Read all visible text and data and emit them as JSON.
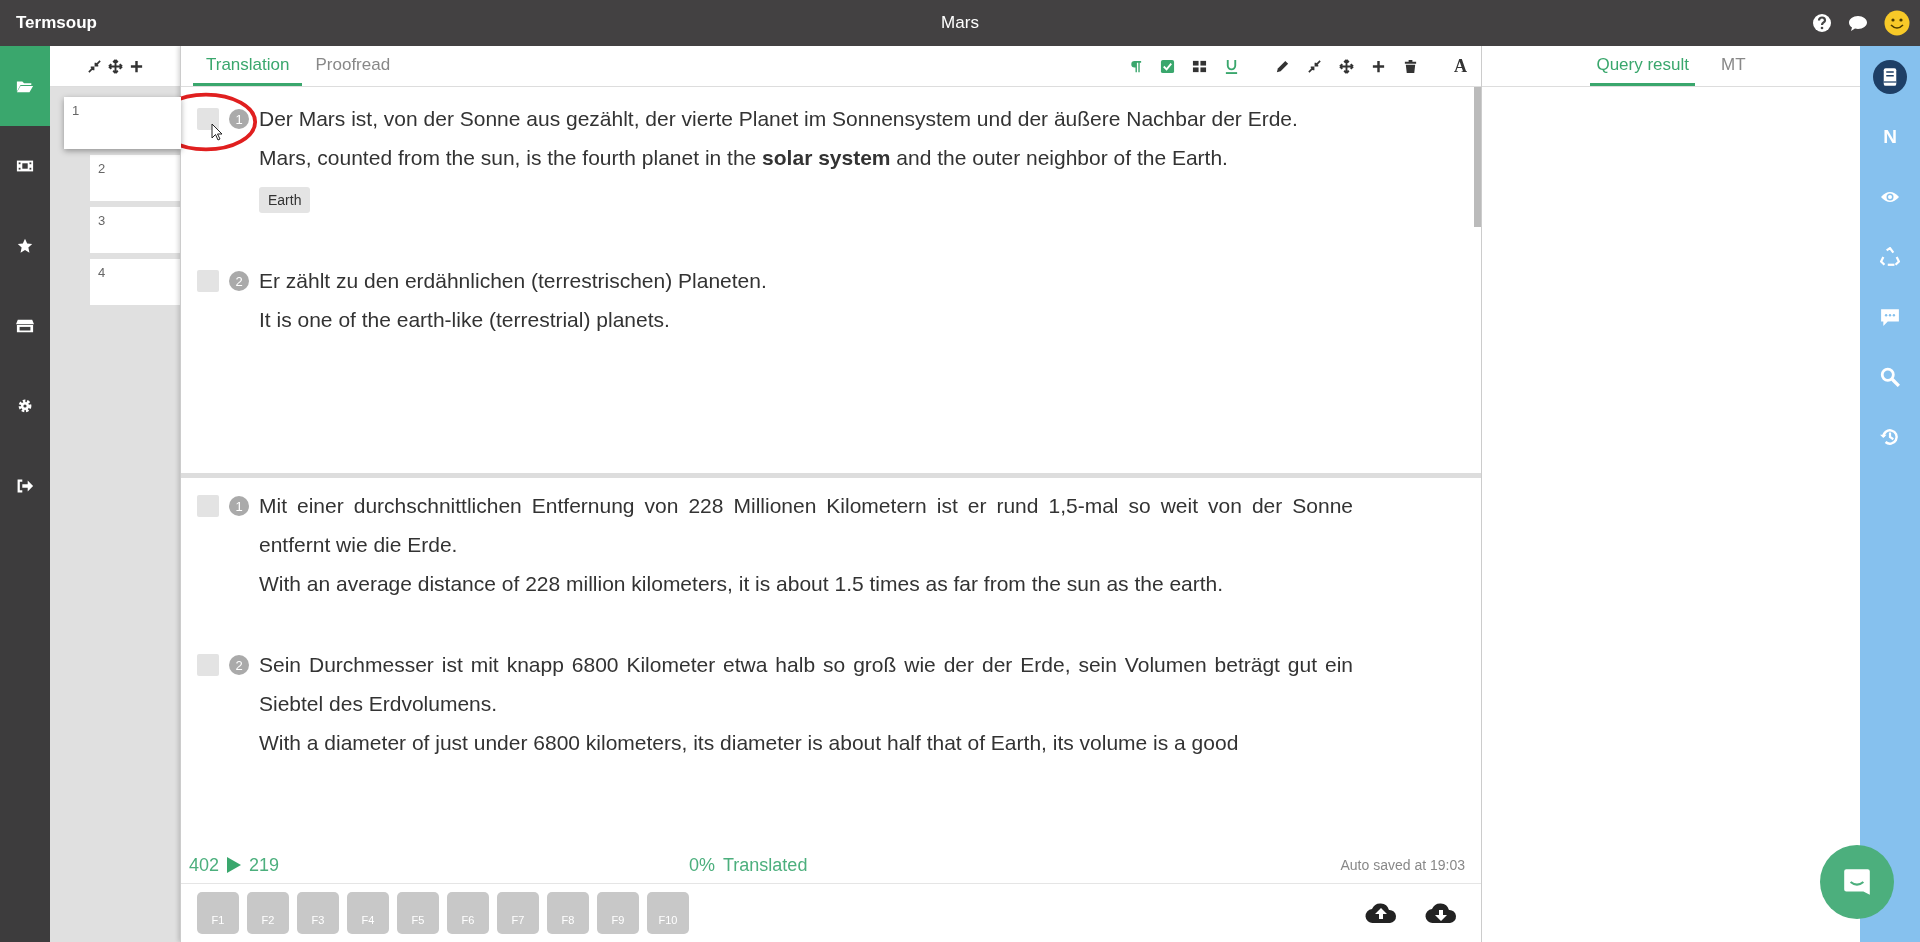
{
  "app": {
    "name": "Termsoup",
    "document_title": "Mars"
  },
  "left_nav": [
    {
      "selected": true
    },
    {
      "selected": false
    },
    {
      "selected": false
    },
    {
      "selected": false
    },
    {
      "selected": false
    },
    {
      "selected": false
    }
  ],
  "pages": [
    {
      "label": "1",
      "selected": true
    },
    {
      "label": "2",
      "selected": false
    },
    {
      "label": "3",
      "selected": false
    },
    {
      "label": "4",
      "selected": false
    }
  ],
  "editor_tabs": [
    {
      "label": "Translation",
      "selected": true
    },
    {
      "label": "Proofread",
      "selected": false
    }
  ],
  "toolbar": {
    "toggles": [
      {
        "on": true
      },
      {
        "on": true
      },
      {
        "on": false
      },
      {
        "on": true
      }
    ],
    "font_button": "A"
  },
  "panes": [
    {
      "segments": [
        {
          "number": "1",
          "checked": false,
          "source": "Der Mars ist, von der Sonne aus gezählt, der vierte Planet im Sonnensystem und der äußere Nachbar der Erde.",
          "target": "Mars, counted from the sun, is the fourth planet in the **solar system** and the outer neighbor of the Earth.",
          "terms": [
            "Earth"
          ]
        },
        {
          "number": "2",
          "checked": false,
          "source": "Er zählt zu den erdähnlichen (terrestrischen) Planeten.",
          "target": "It is one of the earth-like (terrestrial) planets."
        }
      ]
    },
    {
      "segments": [
        {
          "number": "1",
          "checked": false,
          "source": "Mit einer durchschnittlichen Entfernung von 228 Millionen Kilometern ist er rund 1,5-mal so weit von der Sonne entfernt wie die Erde.",
          "target": "With an average distance of 228 million kilometers, it is about 1.5 times as far from the sun as the earth."
        },
        {
          "number": "2",
          "checked": false,
          "source": "Sein Durchmesser ist mit knapp 6800 Kilometer etwa halb so groß wie der der Erde, sein Volumen beträgt gut ein Siebtel des Erdvolumens.",
          "target": "With a diameter of just under 6800 kilometers, its diameter is about half that of Earth, its volume is a good"
        }
      ]
    }
  ],
  "status": {
    "source_count": "402",
    "target_count": "219",
    "progress": "0%",
    "progress_label": "Translated",
    "autosave": "Auto saved at 19:03"
  },
  "function_keys": [
    "F1",
    "F2",
    "F3",
    "F4",
    "F5",
    "F6",
    "F7",
    "F8",
    "F9",
    "F10"
  ],
  "right_tabs": [
    {
      "label": "Query result",
      "selected": true
    },
    {
      "label": "MT",
      "selected": false
    }
  ],
  "right_tools": [
    {
      "selected": true
    },
    {
      "label": "N",
      "selected": false
    },
    {
      "selected": false
    },
    {
      "selected": false
    },
    {
      "selected": false
    },
    {
      "selected": false
    },
    {
      "selected": false
    }
  ]
}
